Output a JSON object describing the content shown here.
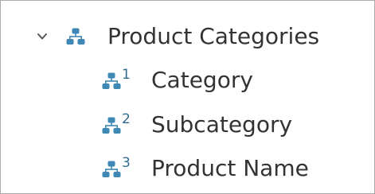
{
  "hierarchy": {
    "label": "Product Categories",
    "expanded": true,
    "icons": {
      "toggle": "chevron-down-icon",
      "hierarchy": "hierarchy-icon"
    },
    "colors": {
      "icon": "#3f88b5",
      "text": "#333333"
    },
    "levels": [
      {
        "number": "1",
        "label": "Category"
      },
      {
        "number": "2",
        "label": "Subcategory"
      },
      {
        "number": "3",
        "label": "Product Name"
      }
    ]
  }
}
